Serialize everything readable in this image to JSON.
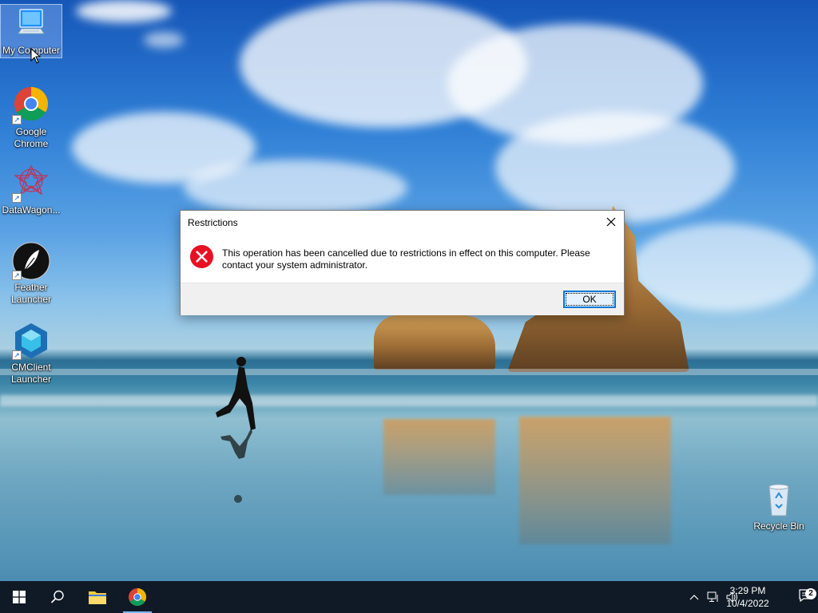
{
  "desktop": {
    "icons": [
      {
        "label": "My Computer",
        "icon": "monitor-icon"
      },
      {
        "label": "Google Chrome",
        "icon": "chrome-icon"
      },
      {
        "label": "DataWagon...",
        "icon": "datawagon-icon"
      },
      {
        "label": "Feather Launcher",
        "icon": "feather-icon"
      },
      {
        "label": "CMClient Launcher",
        "icon": "cmclient-icon"
      },
      {
        "label": "Recycle Bin",
        "icon": "recycle-bin-icon"
      }
    ]
  },
  "dialog": {
    "title": "Restrictions",
    "message": "This operation has been cancelled due to restrictions in effect on this computer. Please contact your system administrator.",
    "ok_label": "OK",
    "icon": "error-icon"
  },
  "taskbar": {
    "pinned": [
      {
        "name": "start",
        "icon": "windows-logo-icon"
      },
      {
        "name": "search",
        "icon": "search-icon"
      },
      {
        "name": "file-explorer",
        "icon": "folder-icon"
      },
      {
        "name": "chrome",
        "icon": "chrome-icon"
      }
    ],
    "tray": {
      "time": "3:29 PM",
      "date": "10/4/2022",
      "notification_count": "2"
    }
  },
  "colors": {
    "accent": "#0078d7",
    "taskbar": "#101a26",
    "error": "#e81123"
  }
}
